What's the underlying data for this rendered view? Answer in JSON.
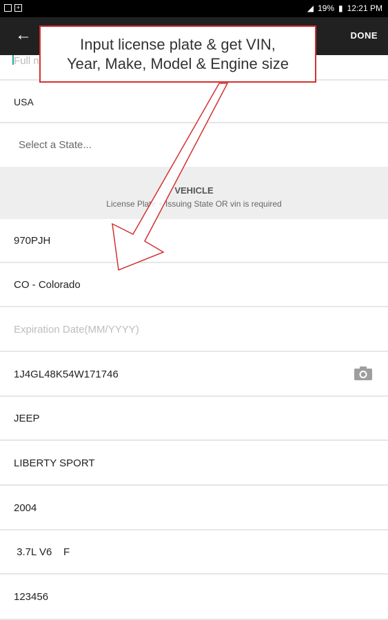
{
  "status_bar": {
    "battery": "19%",
    "time": "12:21 PM"
  },
  "app_bar": {
    "back_icon": "arrow-left-icon",
    "done_label": "DONE"
  },
  "top_partial_field": {
    "value": "Full n"
  },
  "fields_top": [
    {
      "value": "USA"
    },
    {
      "placeholder": "Select a State..."
    }
  ],
  "vehicle_section": {
    "title": "VEHICLE",
    "subtitle": "License Plate + Issuing State OR vin is required"
  },
  "vehicle_fields": {
    "plate": "970PJH",
    "state": "CO - Colorado",
    "expiration_placeholder": "Expiration Date(MM/YYYY)",
    "vin": "1J4GL48K54W171746",
    "make": "JEEP",
    "model": "LIBERTY SPORT",
    "year": "2004",
    "engine": " 3.7L V6    F",
    "other": "123456"
  },
  "callout": {
    "line1": "Input license plate & get VIN,",
    "line2": "Year, Make, Model & Engine size",
    "color": "#d32f2f"
  }
}
